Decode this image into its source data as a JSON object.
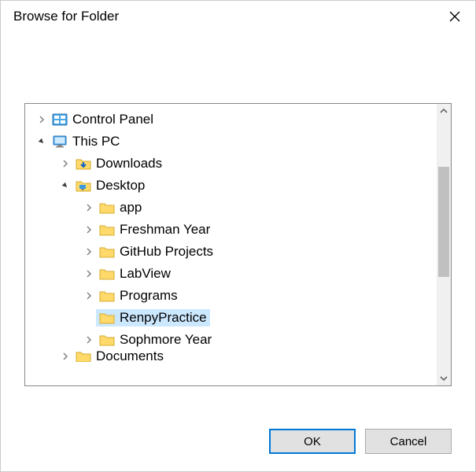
{
  "dialog": {
    "title": "Browse for Folder"
  },
  "tree": {
    "items": [
      {
        "depth": 0,
        "expanded": false,
        "hasChildren": true,
        "icon": "control-panel",
        "label": "Control Panel"
      },
      {
        "depth": 0,
        "expanded": true,
        "hasChildren": true,
        "icon": "this-pc",
        "label": "This PC"
      },
      {
        "depth": 1,
        "expanded": false,
        "hasChildren": true,
        "icon": "downloads",
        "label": "Downloads"
      },
      {
        "depth": 1,
        "expanded": true,
        "hasChildren": true,
        "icon": "desktop",
        "label": "Desktop"
      },
      {
        "depth": 2,
        "expanded": false,
        "hasChildren": true,
        "icon": "folder",
        "label": "app"
      },
      {
        "depth": 2,
        "expanded": false,
        "hasChildren": true,
        "icon": "folder",
        "label": "Freshman Year"
      },
      {
        "depth": 2,
        "expanded": false,
        "hasChildren": true,
        "icon": "folder",
        "label": "GitHub Projects"
      },
      {
        "depth": 2,
        "expanded": false,
        "hasChildren": true,
        "icon": "folder",
        "label": "LabView"
      },
      {
        "depth": 2,
        "expanded": false,
        "hasChildren": true,
        "icon": "folder",
        "label": "Programs"
      },
      {
        "depth": 2,
        "expanded": false,
        "hasChildren": false,
        "icon": "folder",
        "label": "RenpyPractice",
        "selected": true
      },
      {
        "depth": 2,
        "expanded": false,
        "hasChildren": true,
        "icon": "folder",
        "label": "Sophmore Year"
      },
      {
        "depth": 1,
        "expanded": false,
        "hasChildren": true,
        "icon": "folder",
        "label": "Documents",
        "cut": true
      }
    ]
  },
  "buttons": {
    "ok": "OK",
    "cancel": "Cancel"
  }
}
